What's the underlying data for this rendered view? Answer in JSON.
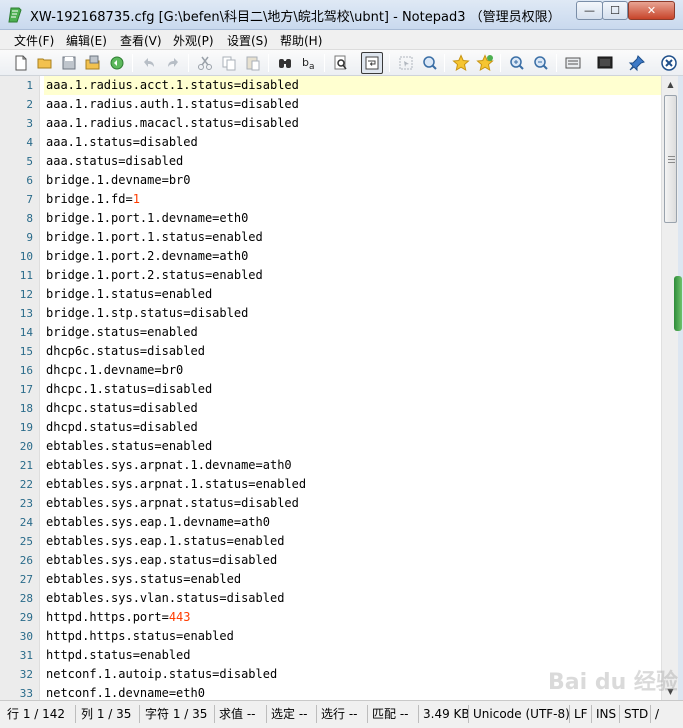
{
  "window": {
    "title": "XW-192168735.cfg [G:\\befen\\科目二\\地方\\皖北驾校\\ubnt] - Notepad3 （管理员权限）",
    "min_glyph": "—",
    "max_glyph": "☐",
    "close_glyph": "✕"
  },
  "menu": [
    "文件(F)",
    "编辑(E)",
    "查看(V)",
    "外观(P)",
    "设置(S)",
    "帮助(H)"
  ],
  "toolbar_icons": [
    "new-file-icon",
    "open-folder-icon",
    "save-icon",
    "save-as-icon",
    "revert-icon",
    "undo-icon",
    "redo-icon",
    "cut-icon",
    "copy-icon",
    "paste-icon",
    "find-icon",
    "replace-icon",
    "find-in-files-icon",
    "word-wrap-icon",
    "select-icon",
    "zoom-find-icon",
    "favorite-icon",
    "add-favorite-icon",
    "zoom-in-icon",
    "zoom-out-icon",
    "settings-icon",
    "run-icon",
    "pin-icon",
    "close-doc-icon"
  ],
  "editor": {
    "lines": [
      {
        "n": "1",
        "parts": [
          {
            "t": "aaa.1.radius.acct.1.status=disabled"
          }
        ]
      },
      {
        "n": "2",
        "parts": [
          {
            "t": "aaa.1.radius.auth.1.status=disabled"
          }
        ]
      },
      {
        "n": "3",
        "parts": [
          {
            "t": "aaa.1.radius.macacl.status=disabled"
          }
        ]
      },
      {
        "n": "4",
        "parts": [
          {
            "t": "aaa.1.status=disabled"
          }
        ]
      },
      {
        "n": "5",
        "parts": [
          {
            "t": "aaa.status=disabled"
          }
        ]
      },
      {
        "n": "6",
        "parts": [
          {
            "t": "bridge.1.devname=br0"
          }
        ]
      },
      {
        "n": "7",
        "parts": [
          {
            "t": "bridge.1.fd="
          },
          {
            "t": "1",
            "num": true
          }
        ]
      },
      {
        "n": "8",
        "parts": [
          {
            "t": "bridge.1.port.1.devname=eth0"
          }
        ]
      },
      {
        "n": "9",
        "parts": [
          {
            "t": "bridge.1.port.1.status=enabled"
          }
        ]
      },
      {
        "n": "10",
        "parts": [
          {
            "t": "bridge.1.port.2.devname=ath0"
          }
        ]
      },
      {
        "n": "11",
        "parts": [
          {
            "t": "bridge.1.port.2.status=enabled"
          }
        ]
      },
      {
        "n": "12",
        "parts": [
          {
            "t": "bridge.1.status=enabled"
          }
        ]
      },
      {
        "n": "13",
        "parts": [
          {
            "t": "bridge.1.stp.status=disabled"
          }
        ]
      },
      {
        "n": "14",
        "parts": [
          {
            "t": "bridge.status=enabled"
          }
        ]
      },
      {
        "n": "15",
        "parts": [
          {
            "t": "dhcp6c.status=disabled"
          }
        ]
      },
      {
        "n": "16",
        "parts": [
          {
            "t": "dhcpc.1.devname=br0"
          }
        ]
      },
      {
        "n": "17",
        "parts": [
          {
            "t": "dhcpc.1.status=disabled"
          }
        ]
      },
      {
        "n": "18",
        "parts": [
          {
            "t": "dhcpc.status=disabled"
          }
        ]
      },
      {
        "n": "19",
        "parts": [
          {
            "t": "dhcpd.status=disabled"
          }
        ]
      },
      {
        "n": "20",
        "parts": [
          {
            "t": "ebtables.status=enabled"
          }
        ]
      },
      {
        "n": "21",
        "parts": [
          {
            "t": "ebtables.sys.arpnat.1.devname=ath0"
          }
        ]
      },
      {
        "n": "22",
        "parts": [
          {
            "t": "ebtables.sys.arpnat.1.status=enabled"
          }
        ]
      },
      {
        "n": "23",
        "parts": [
          {
            "t": "ebtables.sys.arpnat.status=disabled"
          }
        ]
      },
      {
        "n": "24",
        "parts": [
          {
            "t": "ebtables.sys.eap.1.devname=ath0"
          }
        ]
      },
      {
        "n": "25",
        "parts": [
          {
            "t": "ebtables.sys.eap.1.status=enabled"
          }
        ]
      },
      {
        "n": "26",
        "parts": [
          {
            "t": "ebtables.sys.eap.status=disabled"
          }
        ]
      },
      {
        "n": "27",
        "parts": [
          {
            "t": "ebtables.sys.status=enabled"
          }
        ]
      },
      {
        "n": "28",
        "parts": [
          {
            "t": "ebtables.sys.vlan.status=disabled"
          }
        ]
      },
      {
        "n": "29",
        "parts": [
          {
            "t": "httpd.https.port="
          },
          {
            "t": "443",
            "num": true
          }
        ]
      },
      {
        "n": "30",
        "parts": [
          {
            "t": "httpd.https.status=enabled"
          }
        ]
      },
      {
        "n": "31",
        "parts": [
          {
            "t": "httpd.status=enabled"
          }
        ]
      },
      {
        "n": "32",
        "parts": [
          {
            "t": "netconf.1.autoip.status=disabled"
          }
        ]
      },
      {
        "n": "33",
        "parts": [
          {
            "t": "netconf.1.devname=eth0"
          }
        ]
      }
    ]
  },
  "statusbar": {
    "line": "行  1 / 142",
    "col": "列  1 / 35",
    "char": "字符  1 / 35",
    "value": "求值  --",
    "sel": "选定  --",
    "selline": "选行  --",
    "match": "匹配  --",
    "size": "3.49 KB",
    "encoding": "Unicode (UTF-8)",
    "eol": "LF",
    "ins": "INS",
    "std": "STD",
    "lang": "/"
  },
  "watermark": "Bai du 经验",
  "colors": {
    "number": "#ff3c00",
    "linenum": "#2a6b8a",
    "current_line": "#ffffd0"
  }
}
